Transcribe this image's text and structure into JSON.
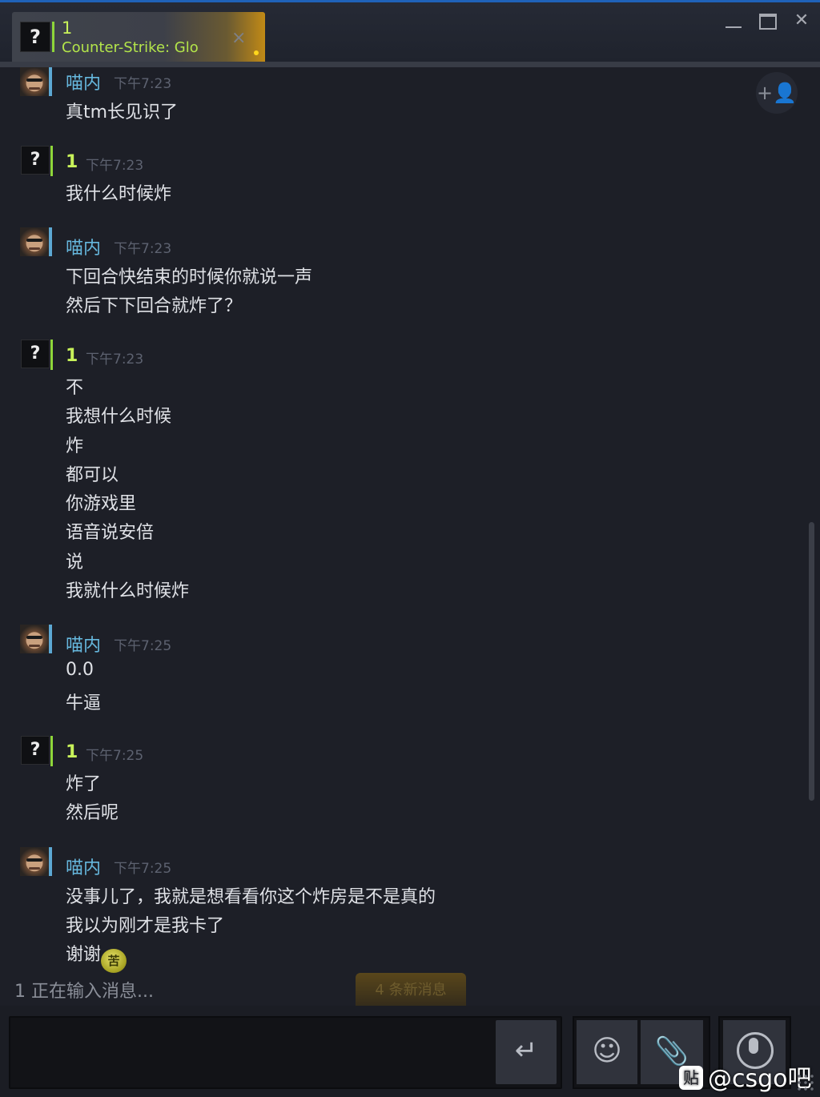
{
  "tab": {
    "avatar_glyph": "?",
    "name": "1",
    "game": "Counter-Strike: Glo",
    "close_glyph": "×"
  },
  "window": {
    "minimize_glyph": "_",
    "maximize_glyph": "□",
    "close_glyph": "✕"
  },
  "add_friend_icon": "add-friend-icon",
  "messages": [
    {
      "sender": "喵内",
      "type": "friend",
      "time": "下午7:23",
      "lines": [
        "真tm长见识了"
      ]
    },
    {
      "sender": "1",
      "type": "self",
      "time": "下午7:23",
      "lines": [
        "我什么时候炸"
      ]
    },
    {
      "sender": "喵内",
      "type": "friend",
      "time": "下午7:23",
      "lines": [
        "下回合快结束的时候你就说一声",
        "然后下下回合就炸了？"
      ]
    },
    {
      "sender": "1",
      "type": "self",
      "time": "下午7:23",
      "lines": [
        "不",
        "我想什么时候",
        "炸",
        "都可以",
        "你游戏里",
        "语音说安倍",
        "说",
        "我就什么时候炸"
      ]
    },
    {
      "sender": "喵内",
      "type": "friend",
      "time": "下午7:25",
      "lines": [
        "0.0",
        "牛逼"
      ]
    },
    {
      "sender": "1",
      "type": "self",
      "time": "下午7:25",
      "lines": [
        "炸了",
        "然后呢"
      ]
    },
    {
      "sender": "喵内",
      "type": "friend",
      "time": "下午7:25",
      "lines": [
        "没事儿了，我就是想看看你这个炸房是不是真的",
        "我以为刚才是我卡了",
        "谢谢"
      ]
    }
  ],
  "avatar_glyph": "?",
  "emoji_glyph": "苦",
  "typing_status": "1 正在输入消息...",
  "new_messages": "4 条新消息",
  "composer": {
    "input_value": "",
    "send_glyph": "↵",
    "emoji_glyph": "☺",
    "attach_glyph": "📎"
  },
  "watermark": {
    "badge": "贴",
    "text": "@csgo吧"
  }
}
